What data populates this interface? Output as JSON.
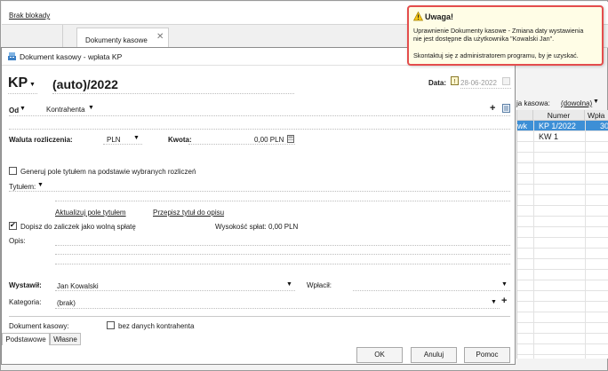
{
  "top_link": "Brak blokady",
  "tabs": {
    "doc_tab_label": "Dokumenty kasowe",
    "close_glyph": "✕"
  },
  "background_table": {
    "filter_label": "ja kasowa:",
    "filter_value": "(dowolna)",
    "headers": [
      "Numer",
      "Wpła"
    ],
    "rows": [
      {
        "prefix": "wk",
        "numer": "KP 1/2022",
        "wplata": "30",
        "selected": true
      },
      {
        "prefix": "",
        "numer": "KW 1",
        "wplata": "",
        "selected": false
      }
    ]
  },
  "dialog": {
    "title": "Dokument kasowy - wpłata KP",
    "doc_type": "KP",
    "doc_number": "(auto)/2022",
    "date_label": "Data:",
    "date_value": "28-06-2022",
    "od_label": "Od",
    "kontrahenta_label": "Kontrahenta",
    "plus_glyph": "+",
    "waluta_label": "Waluta rozliczenia:",
    "waluta_value": "PLN",
    "kwota_label": "Kwota:",
    "kwota_value": "0,00 PLN",
    "generuj_label": "Generuj pole tytułem na podstawie wybranych rozliczeń",
    "tytulem_label": "Tytułem:",
    "aktualizuj_link": "Aktualizuj pole tytułem",
    "przepisz_link": "Przepisz tytuł do opisu",
    "dopisz_label": "Dopisz do zaliczek jako wolną spłatę",
    "wysokosc_label": "Wysokość spłat: 0,00 PLN",
    "opis_label": "Opis:",
    "wystawil_label": "Wystawił:",
    "wystawil_value": "Jan Kowalski",
    "wplacil_label": "Wpłacił:",
    "kategoria_label": "Kategoria:",
    "kategoria_value": "(brak)",
    "dokument_kasowy_label": "Dokument kasowy:",
    "bez_danych_label": "bez danych kontrahenta",
    "bottom_tabs": [
      "Podstawowe",
      "Własne"
    ],
    "buttons": {
      "ok": "OK",
      "cancel": "Anuluj",
      "help": "Pomoc"
    }
  },
  "popup": {
    "title": "Uwaga!",
    "line1": "Uprawnienie Dokumenty kasowe - Zmiana daty wystawienia",
    "line2": "nie jest dostępne dla użytkownika \"Kowalski Jan\".",
    "line3": "Skontaktuj się z administratorem programu, by je uzyskać."
  },
  "colors": {
    "popup_border": "#e44d4d",
    "popup_bg": "#fffde6",
    "selected_row": "#3d8fd6"
  }
}
